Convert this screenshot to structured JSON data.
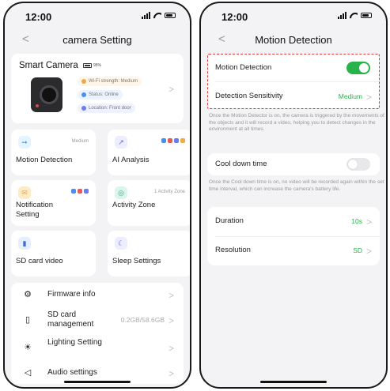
{
  "left": {
    "status": {
      "time": "12:00"
    },
    "nav": {
      "back": "<",
      "title": "camera Setting"
    },
    "camera": {
      "name": "Smart Camera",
      "battery": "95%",
      "wifi": "Wi-Fi strength: Medium",
      "status": "Status: Online",
      "location": "Location: Front door"
    },
    "tiles": {
      "motion": {
        "label": "Motion Detection",
        "meta": "Medium"
      },
      "ai": {
        "label": "AI Analysis"
      },
      "notification": {
        "label": "Notification Setting"
      },
      "zone": {
        "label": "Activity Zone",
        "meta": "1 Activity Zone"
      },
      "sd": {
        "label": "SD card video"
      },
      "sleep": {
        "label": "Sleep Settings"
      }
    },
    "list": {
      "firmware": {
        "label": "Firmware info"
      },
      "sd_management": {
        "label": "SD card management",
        "value": "0.2GB/58.6GB"
      },
      "lighting": {
        "label": "Lighting Setting"
      },
      "audio": {
        "label": "Audio settings"
      }
    }
  },
  "right": {
    "status": {
      "time": "12:00"
    },
    "nav": {
      "back": "<",
      "title": "Motion Detection"
    },
    "motion_detection": {
      "label": "Motion Detection",
      "enabled": true
    },
    "sensitivity": {
      "label": "Detection Sensitivity",
      "value": "Medium"
    },
    "motion_note": "Once the Motion Detector is on, the camera is triggered by the movements of the objects and it will record a video, helping you to detect changes in the environment at all times.",
    "cool_down": {
      "label": "Cool down time",
      "enabled": false
    },
    "cool_note": "Once the  Cool down time is on, no video will be recorded again within the set time interval, which can increase the camera's battery life.",
    "duration": {
      "label": "Duration",
      "value": "10s"
    },
    "resolution": {
      "label": "Resolution",
      "value": "SD"
    }
  },
  "colors": {
    "accent_green": "#27b24a",
    "highlight_red": "#e03a3a",
    "background": "#f3f3f5",
    "card": "#ffffff"
  },
  "icons": {
    "tiles": [
      "running-person-icon",
      "chart-icon",
      "envelope-icon",
      "target-icon",
      "sd-card-icon",
      "moon-icon"
    ],
    "list": [
      "chip-icon",
      "sd-card-outline-icon",
      "lightbulb-icon",
      "speaker-icon"
    ]
  }
}
